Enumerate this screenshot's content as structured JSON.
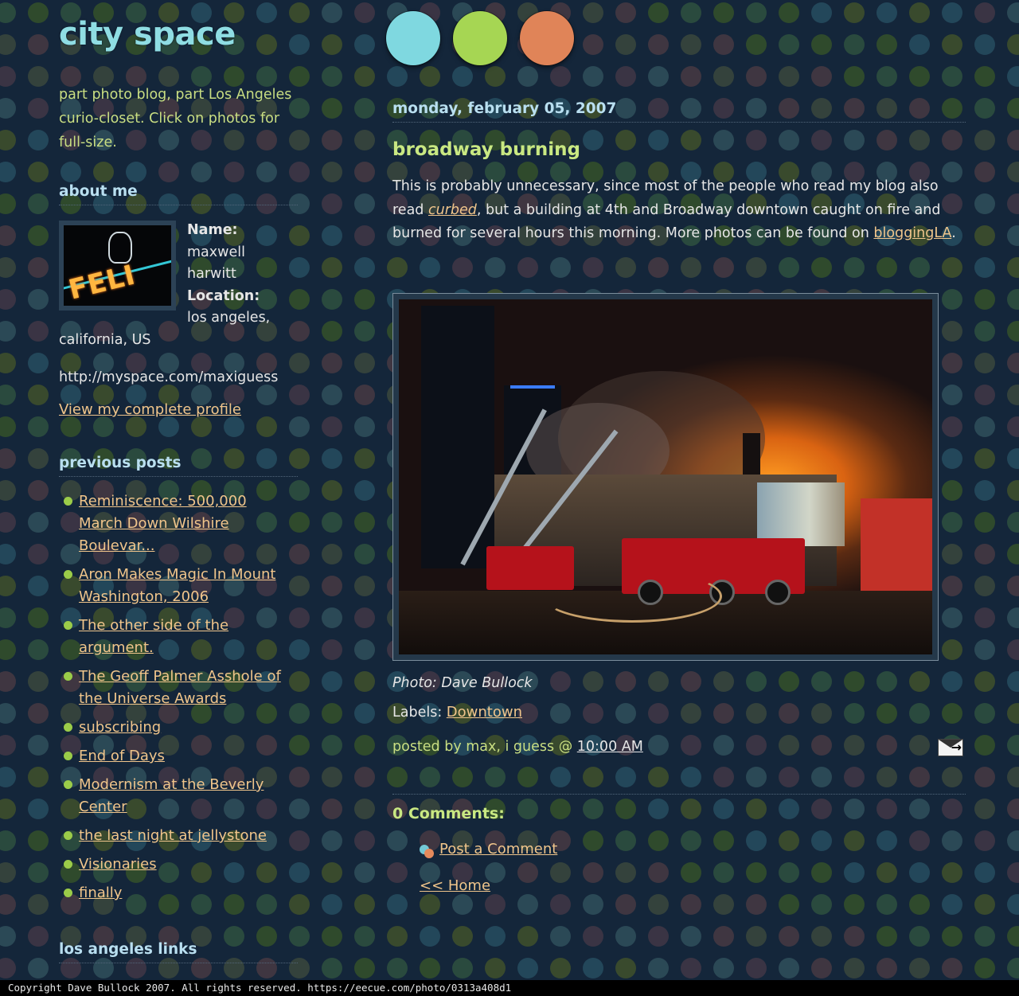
{
  "colors": {
    "background": "#14263a",
    "title": "#8fdde3",
    "accent_green": "#c9e882",
    "link": "#f0c58b",
    "circle_cyan": "#7fd8e0",
    "circle_green": "#a6d653",
    "circle_orange": "#e08458"
  },
  "header": {
    "blog_title": "city space",
    "description": "part photo blog, part Los Angeles curio-closet. Click on photos for full-size."
  },
  "sidebar": {
    "about_heading": "about me",
    "profile": {
      "name_label": "Name:",
      "name_line1": "maxwell",
      "name_line2": "harwitt",
      "location_label": "Location:",
      "location_line1": "los angeles,",
      "location_line2": "california, US",
      "website": "http://myspace.com/maxiguess",
      "complete_profile_link": "View my complete profile",
      "photo_sign_text": "FELI"
    },
    "previous_heading": "previous posts",
    "previous_posts": [
      {
        "lines": [
          "Reminiscence: 500,000",
          "March Down Wilshire",
          "Boulevar..."
        ]
      },
      {
        "lines": [
          "Aron Makes Magic In Mount",
          "Washington, 2006"
        ]
      },
      {
        "lines": [
          "The other side of the",
          "argument."
        ]
      },
      {
        "lines": [
          "The Geoff Palmer Asshole of",
          "the Universe Awards"
        ]
      },
      {
        "lines": [
          "subscribing"
        ]
      },
      {
        "lines": [
          "End of Days"
        ]
      },
      {
        "lines": [
          "Modernism at the Beverly",
          "Center"
        ]
      },
      {
        "lines": [
          "the last night at jellystone"
        ]
      },
      {
        "lines": [
          "Visionaries"
        ]
      },
      {
        "lines": [
          "finally"
        ]
      }
    ],
    "links_heading": "los angeles links"
  },
  "post": {
    "date": "monday, february 05, 2007",
    "title": "broadway burning",
    "body_part1": "This is probably unnecessary, since most of the people who read my blog also read ",
    "body_link1": "curbed",
    "body_part2": ", but a building at 4th and Broadway downtown caught on fire and burned for several hours this morning. More photos can be found on ",
    "body_link2": "bloggingLA",
    "body_part3": ".",
    "photo_caption": "Photo: Dave Bullock",
    "labels_prefix": "Labels: ",
    "label_link": "Downtown",
    "posted_by": "posted by max, i guess @ ",
    "time": "10:00 AM",
    "email_icon": "email-post-icon"
  },
  "comments": {
    "heading": "0 Comments:",
    "post_comment_link": "Post a Comment",
    "home_link": "<< Home"
  },
  "footer": {
    "text": "Copyright Dave Bullock 2007. All rights reserved. https://eecue.com/photo/0313a408d1"
  }
}
